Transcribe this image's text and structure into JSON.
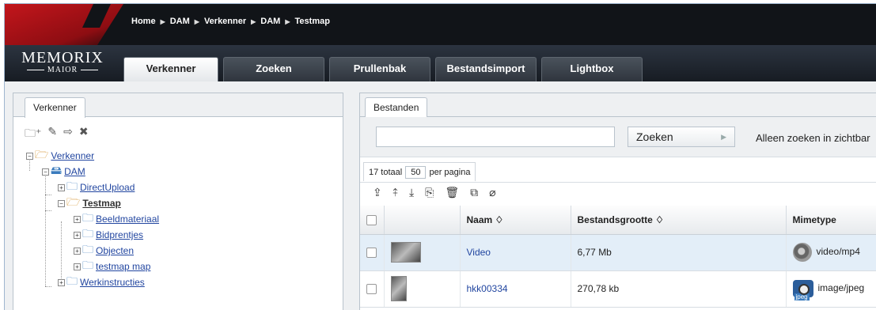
{
  "breadcrumb": [
    "Home",
    "DAM",
    "Verkenner",
    "DAM",
    "Testmap"
  ],
  "logo": {
    "line1": "MEMORIX",
    "line2": "MAIOR"
  },
  "tabs": [
    {
      "label": "Verkenner",
      "active": true
    },
    {
      "label": "Zoeken",
      "active": false
    },
    {
      "label": "Prullenbak",
      "active": false
    },
    {
      "label": "Bestandsimport",
      "active": false
    },
    {
      "label": "Lightbox",
      "active": false
    }
  ],
  "left_panel": {
    "tab": "Verkenner",
    "toolbar_icons": [
      "new-folder-icon",
      "edit-folder-icon",
      "move-folder-icon",
      "delete-folder-icon"
    ],
    "tree": [
      {
        "label": "Verkenner",
        "level": 0
      },
      {
        "label": "DAM",
        "level": 1
      },
      {
        "label": "DirectUpload",
        "level": 2
      },
      {
        "label": "Testmap",
        "level": 2,
        "selected": true
      },
      {
        "label": "Beeldmateriaal",
        "level": 3
      },
      {
        "label": "Bidprentjes",
        "level": 3
      },
      {
        "label": "Objecten",
        "level": 3
      },
      {
        "label": "testmap map",
        "level": 3
      },
      {
        "label": "Werkinstructies",
        "level": 2
      }
    ]
  },
  "right_panel": {
    "tab": "Bestanden",
    "search_button": "Zoeken",
    "only_visible_label": "Alleen zoeken in zichtbar",
    "total_label": "17 totaal",
    "per_page_value": "50",
    "per_page_label": "per pagina",
    "columns": [
      "Naam ♢",
      "Bestandsgrootte ♢",
      "Mimetype"
    ],
    "rows": [
      {
        "name": "Video",
        "size": "6,77 Mb",
        "mimetype": "video/mp4",
        "selected": true
      },
      {
        "name": "hkk00334",
        "size": "270,78 kb",
        "mimetype": "image/jpeg",
        "badge": "jpeg",
        "selected": false
      }
    ]
  },
  "colors": {
    "header_bg": "#111418",
    "accent_red": "#c3161c",
    "link": "#2246a0",
    "selected_row": "#e3eef8"
  }
}
